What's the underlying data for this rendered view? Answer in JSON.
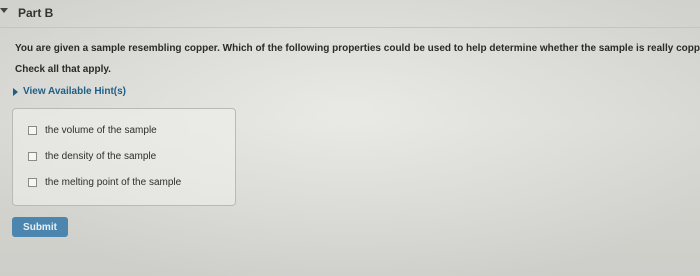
{
  "part": {
    "title": "Part B"
  },
  "question": {
    "text": "You are given a sample resembling copper. Which of the following properties could be used to help determine whether the sample is really copper?",
    "instruction": "Check all that apply."
  },
  "hints": {
    "label": "View Available Hint(s)"
  },
  "options": [
    {
      "label": "the volume of the sample",
      "checked": false
    },
    {
      "label": "the density of the sample",
      "checked": false
    },
    {
      "label": "the melting point of the sample",
      "checked": false
    }
  ],
  "submit": {
    "label": "Submit"
  },
  "colors": {
    "link": "#1f5f86",
    "submit_bg": "#4c86ae"
  },
  "icons": {
    "part_toggle": "caret-down-icon",
    "hint_toggle": "caret-right-icon"
  }
}
